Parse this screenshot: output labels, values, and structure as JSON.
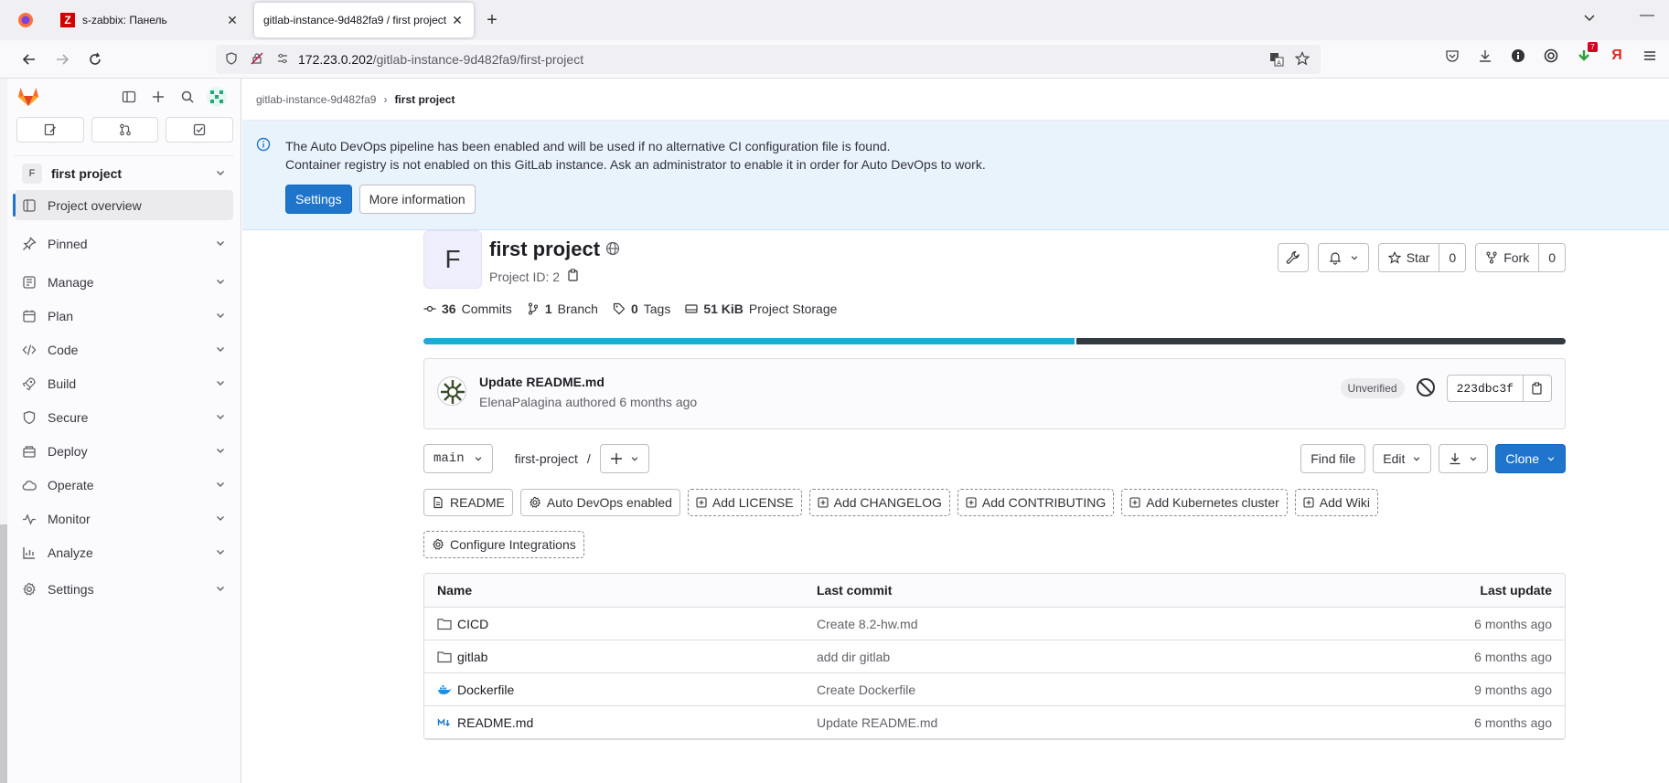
{
  "browser": {
    "tabs": [
      {
        "title": "s-zabbix: Панель",
        "favicon_letter": "Z"
      },
      {
        "title": "gitlab-instance-9d482fa9 / first project",
        "active": true
      }
    ],
    "url_host": "172.23.0.202",
    "url_path": "/gitlab-instance-9d482fa9/first-project",
    "ya_letter": "Я",
    "badge_count": "7"
  },
  "sidebar": {
    "project_initial": "F",
    "project_name": "first project",
    "items": [
      {
        "label": "Project overview",
        "icon": "project-icon",
        "active": true
      },
      {
        "label": "Pinned",
        "icon": "pin-icon"
      },
      {
        "label": "Manage",
        "icon": "users-icon"
      },
      {
        "label": "Plan",
        "icon": "plan-icon"
      },
      {
        "label": "Code",
        "icon": "code-icon"
      },
      {
        "label": "Build",
        "icon": "rocket-icon"
      },
      {
        "label": "Secure",
        "icon": "shield-icon"
      },
      {
        "label": "Deploy",
        "icon": "deployments-icon"
      },
      {
        "label": "Operate",
        "icon": "cloud-icon"
      },
      {
        "label": "Monitor",
        "icon": "monitor-icon"
      },
      {
        "label": "Analyze",
        "icon": "chart-icon"
      },
      {
        "label": "Settings",
        "icon": "gear-icon"
      }
    ]
  },
  "breadcrumb": {
    "group": "gitlab-instance-9d482fa9",
    "project": "first project"
  },
  "banner": {
    "line1": "The Auto DevOps pipeline has been enabled and will be used if no alternative CI configuration file is found.",
    "line2": "Container registry is not enabled on this GitLab instance. Ask an administrator to enable it in order for Auto DevOps to work.",
    "settings_label": "Settings",
    "more_info_label": "More information"
  },
  "project": {
    "initial": "F",
    "title": "first project",
    "id_text": "Project ID: 2",
    "star_label": "Star",
    "star_count": "0",
    "fork_label": "Fork",
    "fork_count": "0",
    "commits_count": "36",
    "commits_label": "Commits",
    "branch_count": "1",
    "branch_label": "Branch",
    "tags_count": "0",
    "tags_label": "Tags",
    "storage_size": "51 KiB",
    "storage_label": "Project Storage",
    "storage_fraction": 0.57,
    "colors": {
      "primary": "#1aaadb",
      "secondary": "#333b42",
      "accent": "#1f75cb"
    }
  },
  "commit": {
    "title": "Update README.md",
    "author": "ElenaPalagina",
    "meta_suffix": "authored 6 months ago",
    "badge": "Unverified",
    "sha": "223dbc3f"
  },
  "repo": {
    "branch": "main",
    "path": "first-project",
    "path_sep": "/",
    "find_file": "Find file",
    "edit": "Edit",
    "clone": "Clone"
  },
  "quick_buttons": [
    {
      "label": "README",
      "dashed": false,
      "icon": "doc-icon"
    },
    {
      "label": "Auto DevOps enabled",
      "dashed": false,
      "icon": "gear-icon"
    },
    {
      "label": "Add LICENSE",
      "dashed": true,
      "icon": "plus-square-icon"
    },
    {
      "label": "Add CHANGELOG",
      "dashed": true,
      "icon": "plus-square-icon"
    },
    {
      "label": "Add CONTRIBUTING",
      "dashed": true,
      "icon": "plus-square-icon"
    },
    {
      "label": "Add Kubernetes cluster",
      "dashed": true,
      "icon": "plus-square-icon"
    },
    {
      "label": "Add Wiki",
      "dashed": true,
      "icon": "plus-square-icon"
    },
    {
      "label": "Configure Integrations",
      "dashed": true,
      "icon": "gear-icon"
    }
  ],
  "files": {
    "headers": {
      "name": "Name",
      "last_commit": "Last commit",
      "last_update": "Last update"
    },
    "rows": [
      {
        "name": "CICD",
        "type": "folder",
        "commit": "Create 8.2-hw.md",
        "updated": "6 months ago"
      },
      {
        "name": "gitlab",
        "type": "folder",
        "commit": "add dir gitlab",
        "updated": "6 months ago"
      },
      {
        "name": "Dockerfile",
        "type": "docker",
        "commit": "Create Dockerfile",
        "updated": "9 months ago"
      },
      {
        "name": "README.md",
        "type": "markdown",
        "commit": "Update README.md",
        "updated": "6 months ago"
      }
    ]
  }
}
